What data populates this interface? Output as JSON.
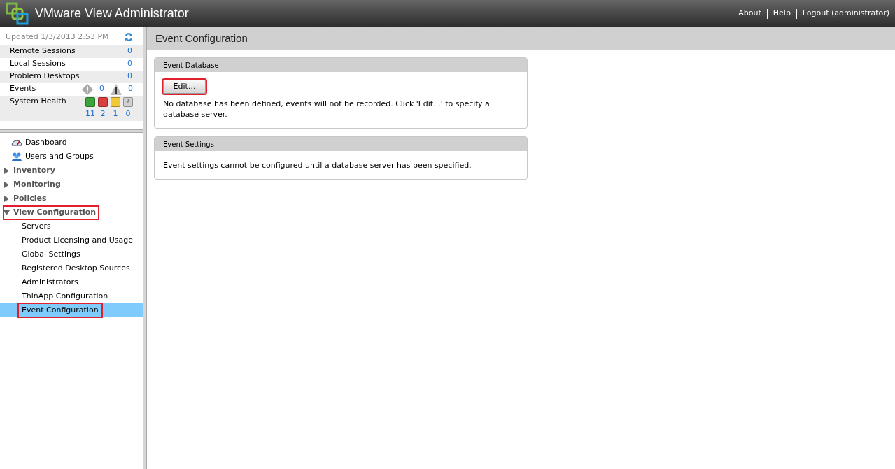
{
  "header": {
    "title": "VMware View Administrator",
    "links": [
      "About",
      "Help",
      "Logout (administrator)"
    ]
  },
  "summary": {
    "updated": "Updated 1/3/2013 2:53 PM",
    "rows": [
      {
        "kind": "count",
        "label": "Remote Sessions",
        "value": "0"
      },
      {
        "kind": "count",
        "label": "Local Sessions",
        "value": "0"
      },
      {
        "kind": "count",
        "label": "Problem Desktops",
        "value": "0"
      },
      {
        "kind": "events",
        "label": "Events",
        "values": [
          "0",
          "0"
        ]
      },
      {
        "kind": "health",
        "label": "System Health",
        "statuses": [
          {
            "color": "#3aa53a",
            "value": "11"
          },
          {
            "color": "#d84040",
            "value": "2"
          },
          {
            "color": "#f0c838",
            "value": "1"
          },
          {
            "color": "#d0d0d0",
            "glyph": "?",
            "value": "0"
          }
        ]
      }
    ]
  },
  "nav": [
    {
      "kind": "link",
      "label": "Dashboard",
      "selected": false,
      "highlighted": false
    },
    {
      "kind": "link",
      "label": "Users and Groups",
      "selected": false,
      "highlighted": false
    },
    {
      "kind": "section",
      "label": "Inventory",
      "expanded": false,
      "highlighted": false
    },
    {
      "kind": "section",
      "label": "Monitoring",
      "expanded": false,
      "highlighted": false
    },
    {
      "kind": "section",
      "label": "Policies",
      "expanded": false,
      "highlighted": false
    },
    {
      "kind": "section",
      "label": "View Configuration",
      "expanded": true,
      "highlighted": true,
      "children": [
        {
          "label": "Servers",
          "selected": false,
          "highlighted": false
        },
        {
          "label": "Product Licensing and Usage",
          "selected": false,
          "highlighted": false
        },
        {
          "label": "Global Settings",
          "selected": false,
          "highlighted": false
        },
        {
          "label": "Registered Desktop Sources",
          "selected": false,
          "highlighted": false
        },
        {
          "label": "Administrators",
          "selected": false,
          "highlighted": false
        },
        {
          "label": "ThinApp Configuration",
          "selected": false,
          "highlighted": false
        },
        {
          "label": "Event Configuration",
          "selected": true,
          "highlighted": true
        }
      ]
    }
  ],
  "page": {
    "title": "Event Configuration",
    "panels": [
      {
        "title": "Event Database",
        "button": {
          "label": "Edit...",
          "highlighted": true
        },
        "text": "No database has been defined, events will not be recorded. Click 'Edit...' to specify a database server."
      },
      {
        "title": "Event Settings",
        "text": "Event settings cannot be configured until a database server has been specified."
      }
    ]
  }
}
